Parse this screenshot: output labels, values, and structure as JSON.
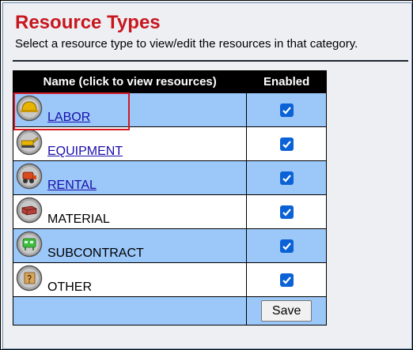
{
  "page": {
    "title": "Resource Types",
    "subtitle": "Select a resource type to view/edit the resources in that category."
  },
  "table": {
    "headers": {
      "name": "Name (click to view resources)",
      "enabled": "Enabled"
    },
    "rows": [
      {
        "label": "LABOR",
        "is_link": true,
        "enabled": true,
        "icon": "hard-hat-icon"
      },
      {
        "label": "EQUIPMENT",
        "is_link": true,
        "enabled": true,
        "icon": "equipment-icon"
      },
      {
        "label": "RENTAL",
        "is_link": true,
        "enabled": true,
        "icon": "rental-icon"
      },
      {
        "label": "MATERIAL",
        "is_link": false,
        "enabled": true,
        "icon": "material-icon"
      },
      {
        "label": "SUBCONTRACT",
        "is_link": false,
        "enabled": true,
        "icon": "subcontract-icon"
      },
      {
        "label": "OTHER",
        "is_link": false,
        "enabled": true,
        "icon": "other-icon"
      }
    ],
    "save_label": "Save"
  },
  "colors": {
    "title": "#c8161e",
    "row_blue": "#9bc7f9",
    "highlight_box": "#d11a24",
    "checkbox": "#0b62d6"
  }
}
